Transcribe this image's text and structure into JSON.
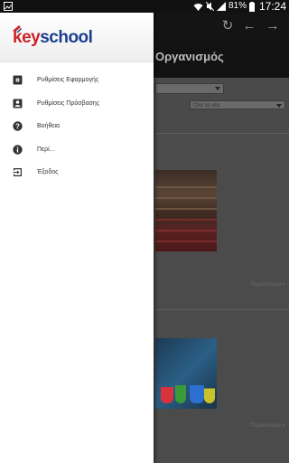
{
  "status_bar": {
    "battery": "81%",
    "time": "17:24",
    "icons": [
      "gallery-icon",
      "wifi-icon",
      "mute-icon",
      "signal-icon",
      "battery-icon"
    ]
  },
  "app": {
    "title": "Οργανισμός",
    "filter_select_value": "",
    "category_select_value": "Όλα τα νέα",
    "cards": [
      {
        "more_link": "Περισσότερα »"
      },
      {
        "more_link": "Περισσότερα »"
      }
    ],
    "toolbar_icons": [
      "refresh-icon",
      "back-arrow-icon",
      "forward-arrow-icon"
    ]
  },
  "drawer": {
    "logo": {
      "key": "key",
      "school": "school"
    },
    "items": [
      {
        "label": "Ρυθμίσεις Εφαρμογής",
        "icon": "settings-icon"
      },
      {
        "label": "Ρυθμίσεις Πρόσβασης",
        "icon": "account-box-icon"
      },
      {
        "label": "Βοήθεια",
        "icon": "help-icon"
      },
      {
        "label": "Περί...",
        "icon": "info-icon"
      },
      {
        "label": "Έξοδος",
        "icon": "exit-icon"
      }
    ]
  },
  "colors": {
    "logo_red": "#cc2429",
    "logo_blue": "#1b3f8f",
    "drawer_bg": "#ffffff",
    "scrim": "#4b4b4b"
  }
}
